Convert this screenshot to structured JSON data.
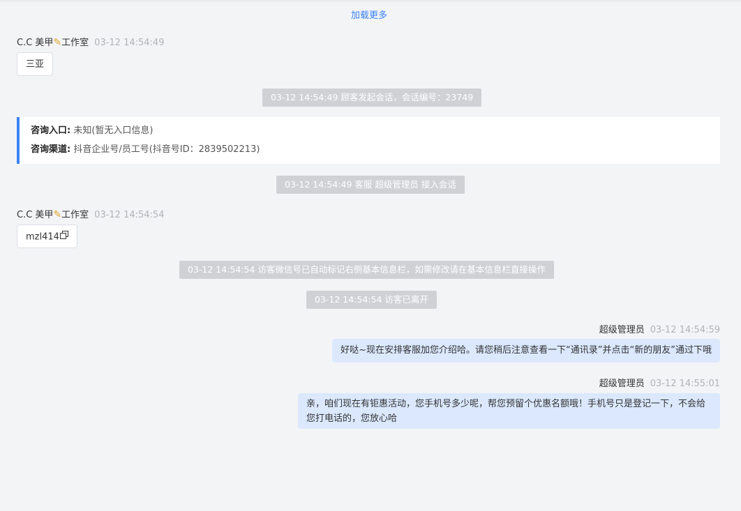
{
  "load_more": "加载更多",
  "messages": {
    "m1": {
      "sender": "C.C 美甲",
      "sender_suffix": "工作室",
      "time": "03-12 14:54:49",
      "text": "三亚"
    },
    "sys1": "03-12 14:54:49 顾客发起会话，会话编号：23749",
    "info": {
      "entry_label": "咨询入口:",
      "entry_value": "未知(暂无入口信息)",
      "channel_label": "咨询渠道:",
      "channel_value": "抖音企业号/员工号(抖音号ID：2839502213)"
    },
    "sys2": "03-12 14:54:49 客服 超级管理员 接入会话",
    "m2": {
      "sender": "C.C 美甲",
      "sender_suffix": "工作室",
      "time": "03-12 14:54:54",
      "text": "mzl414"
    },
    "sys3": "03-12 14:54:54 访客微信号已自动标记右侧基本信息栏，如需修改请在基本信息栏直接操作",
    "sys4": "03-12 14:54:54 访客已离开",
    "r1": {
      "sender": "超级管理员",
      "time": "03-12 14:54:59",
      "text": "好哒~现在安排客服加您介绍哈。请您稍后注意查看一下“通讯录”并点击“新的朋友”通过下哦"
    },
    "r2": {
      "sender": "超级管理员",
      "time": "03-12 14:55:01",
      "line1": "亲，咱们现在有钜惠活动，您手机号多少呢，帮您预留个优惠名额哦！手机号只是登记一下，不会给",
      "line2": "您打电话的，您放心哈"
    }
  },
  "icons": {
    "sender_emoji": "pencil-icon",
    "copy": "copy-icon"
  },
  "colors": {
    "accent": "#3b82f6",
    "system_bg": "#cfd1d5",
    "agent_bubble": "#dbe8fe",
    "background": "#f3f4f6"
  }
}
